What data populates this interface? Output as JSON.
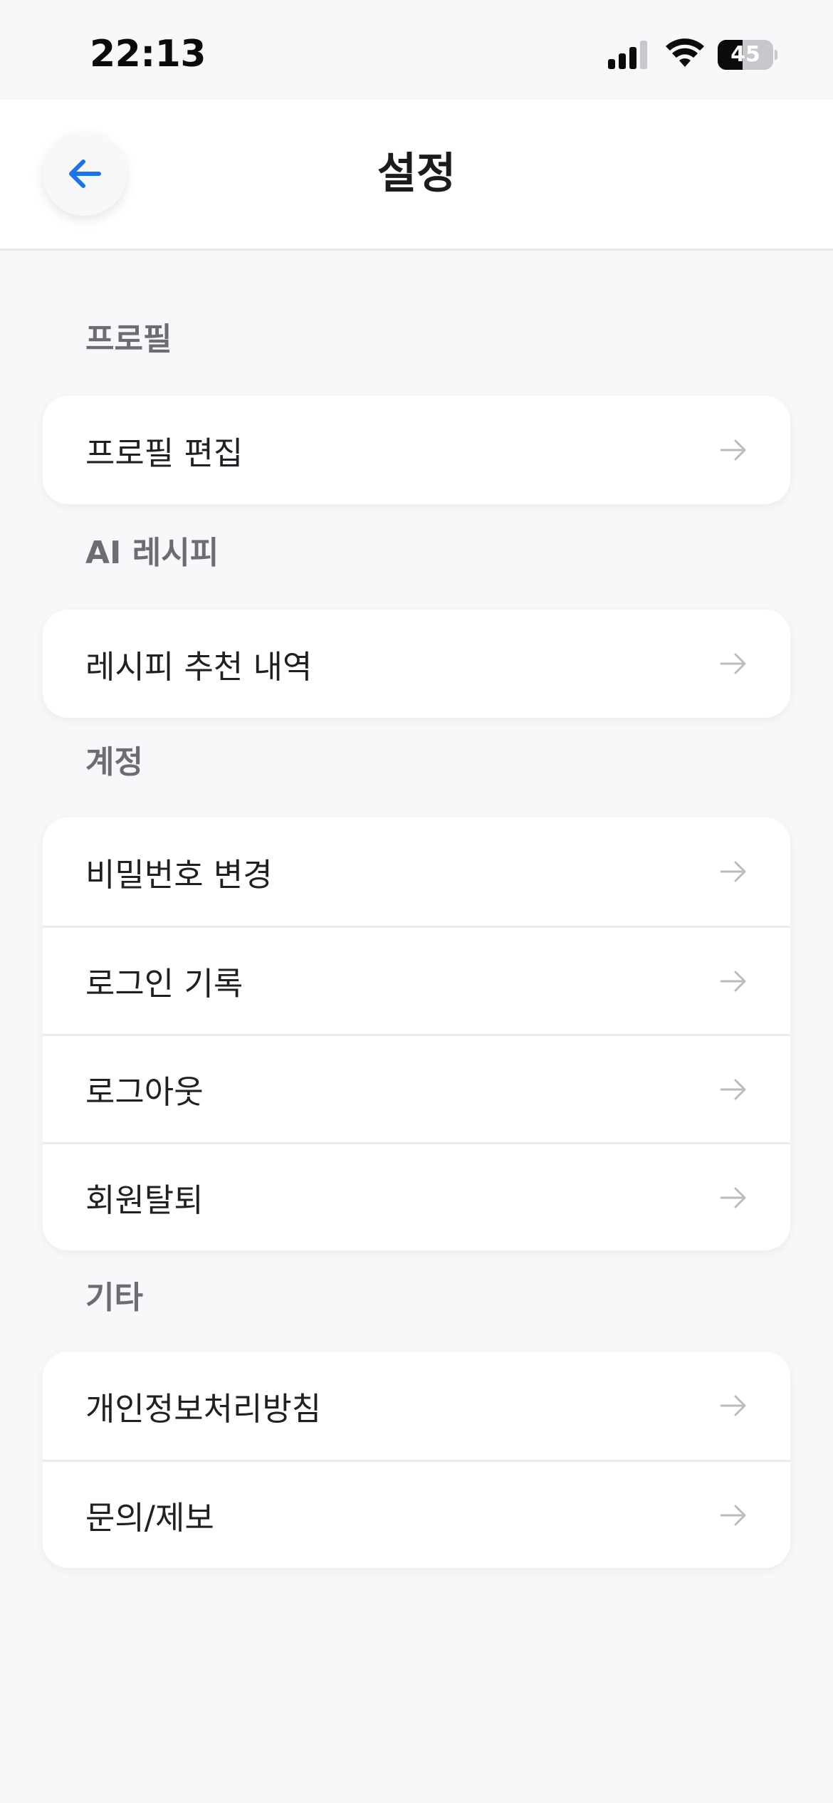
{
  "status_bar": {
    "time": "22:13",
    "battery": "45",
    "battery_level": 0.45,
    "icons": [
      "signal-icon",
      "wifi-icon",
      "battery-icon"
    ]
  },
  "header": {
    "title": "설정",
    "back_icon": "arrow-left-icon"
  },
  "colors": {
    "accent": "#1a73e8",
    "background": "#f7f8fa",
    "card": "#ffffff",
    "section_label": "#6b6d72",
    "arrow": "#b9bbc0"
  },
  "sections": [
    {
      "label": "프로필",
      "items": [
        {
          "label": "프로필 편집"
        }
      ]
    },
    {
      "label": "AI 레시피",
      "items": [
        {
          "label": "레시피 추천 내역"
        }
      ]
    },
    {
      "label": "계정",
      "items": [
        {
          "label": "비밀번호 변경"
        },
        {
          "label": "로그인 기록"
        },
        {
          "label": "로그아웃"
        },
        {
          "label": "회원탈퇴"
        }
      ]
    },
    {
      "label": "기타",
      "items": [
        {
          "label": "개인정보처리방침"
        },
        {
          "label": "문의/제보"
        }
      ]
    }
  ]
}
